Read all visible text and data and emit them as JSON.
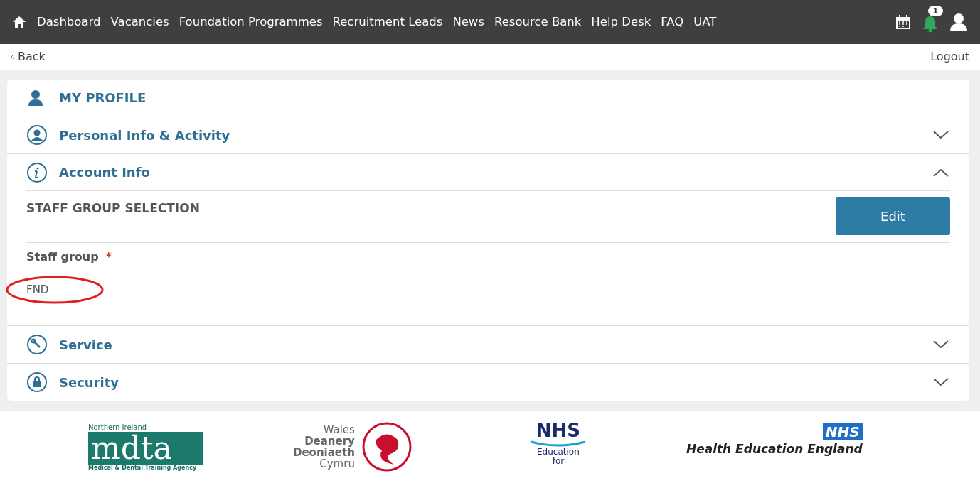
{
  "nav": {
    "items": [
      "Dashboard",
      "Vacancies",
      "Foundation Programmes",
      "Recruitment Leads",
      "News",
      "Resource Bank",
      "Help Desk",
      "FAQ",
      "UAT"
    ],
    "notification_count": "1"
  },
  "subnav": {
    "back": "Back",
    "logout": "Logout"
  },
  "profile": {
    "title": "MY PROFILE",
    "sections": [
      {
        "title": "Personal Info & Activity",
        "expanded": false
      },
      {
        "title": "Account Info",
        "expanded": true,
        "heading": "STAFF GROUP SELECTION",
        "button": "Edit",
        "field_label": "Staff group",
        "required_mark": "*",
        "field_value": "FND"
      },
      {
        "title": "Service",
        "expanded": false
      },
      {
        "title": "Security",
        "expanded": false
      }
    ]
  },
  "footer": {
    "mdta": {
      "top": "Northern Ireland",
      "mark": "mdta",
      "bottom": "Medical & Dental Training Agency"
    },
    "wales": {
      "lines": [
        "Wales",
        "Deanery",
        "Deoniaeth",
        "Cymru"
      ]
    },
    "scotland": {
      "mark": "NHS",
      "lines": [
        "Education",
        "for"
      ]
    },
    "england": {
      "mark": "NHS",
      "name": "Health Education England"
    }
  }
}
